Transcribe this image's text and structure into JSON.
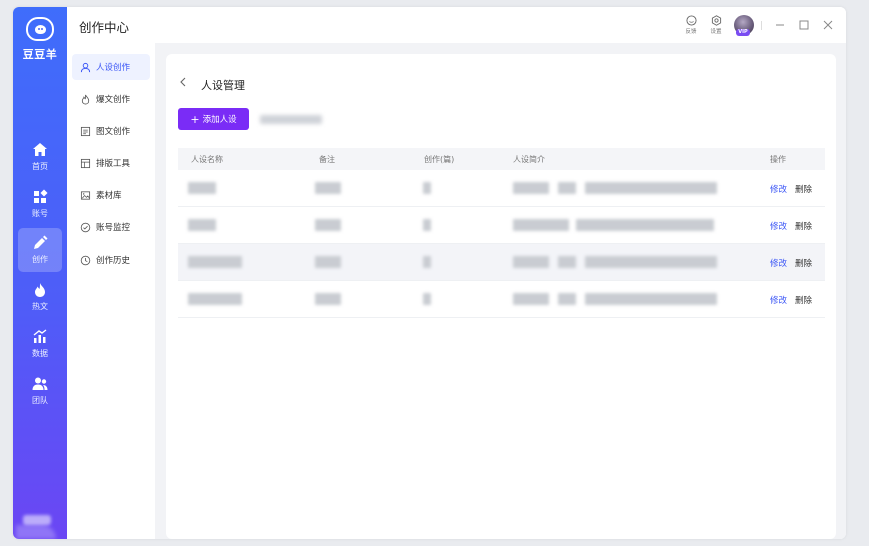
{
  "app": {
    "brand": "豆豆羊",
    "header_title": "创作中心"
  },
  "leftnav": [
    {
      "label": "首页",
      "icon": "home-icon"
    },
    {
      "label": "账号",
      "icon": "grid-icon"
    },
    {
      "label": "创作",
      "icon": "pen-icon",
      "active": true
    },
    {
      "label": "热文",
      "icon": "flame-icon"
    },
    {
      "label": "数据",
      "icon": "chart-icon"
    },
    {
      "label": "团队",
      "icon": "team-icon"
    }
  ],
  "subnav": [
    {
      "label": "人设创作",
      "icon": "user-icon",
      "active": true
    },
    {
      "label": "爆文创作",
      "icon": "fire-outline-icon"
    },
    {
      "label": "图文创作",
      "icon": "document-icon"
    },
    {
      "label": "排版工具",
      "icon": "layout-icon"
    },
    {
      "label": "素材库",
      "icon": "image-icon"
    },
    {
      "label": "账号监控",
      "icon": "check-circle-icon"
    },
    {
      "label": "创作历史",
      "icon": "clock-icon"
    }
  ],
  "header_tools": [
    {
      "label": "反馈",
      "icon": "smile-icon"
    },
    {
      "label": "设置",
      "icon": "settings-icon"
    }
  ],
  "vip_badge": "VIP",
  "page": {
    "title": "人设管理",
    "add_button": "添加人设"
  },
  "table": {
    "columns": [
      "人设名称",
      "备注",
      "创作(篇)",
      "人设简介",
      "操作"
    ],
    "edit_label": "修改",
    "delete_label": "删除",
    "row_count": 4
  },
  "colors": {
    "nav_gradient_top": "#3f6dfb",
    "nav_gradient_bottom": "#6b46f4",
    "primary_button": "#7a2cf6",
    "link": "#3a55f6"
  }
}
